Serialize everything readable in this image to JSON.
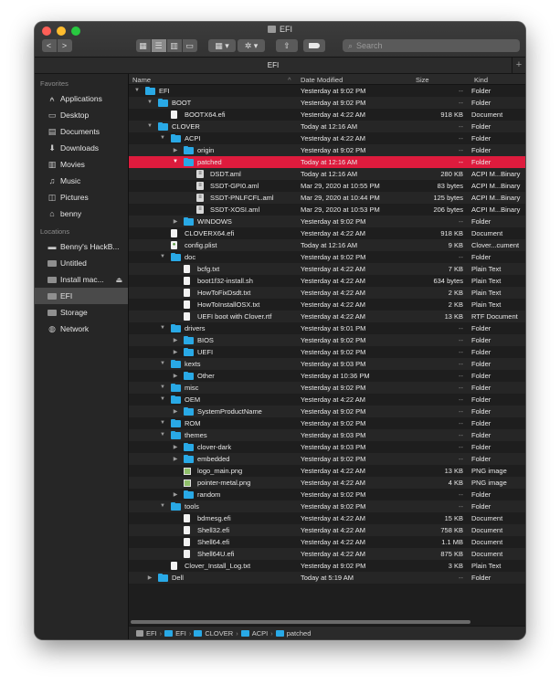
{
  "window": {
    "title": "EFI"
  },
  "toolbar": {
    "back_label": "<",
    "forward_label": ">",
    "search_placeholder": "Search"
  },
  "tab": {
    "title": "EFI",
    "plus": "+"
  },
  "sidebar": {
    "favorites_header": "Favorites",
    "favorites": [
      {
        "label": "Applications",
        "icon": "applications-icon"
      },
      {
        "label": "Desktop",
        "icon": "desktop-icon"
      },
      {
        "label": "Documents",
        "icon": "documents-icon"
      },
      {
        "label": "Downloads",
        "icon": "downloads-icon"
      },
      {
        "label": "Movies",
        "icon": "movies-icon"
      },
      {
        "label": "Music",
        "icon": "music-icon"
      },
      {
        "label": "Pictures",
        "icon": "pictures-icon"
      },
      {
        "label": "benny",
        "icon": "home-icon"
      }
    ],
    "locations_header": "Locations",
    "locations": [
      {
        "label": "Benny's HackB...",
        "icon": "computer-icon"
      },
      {
        "label": "Untitled",
        "icon": "drive-icon"
      },
      {
        "label": "Install mac...",
        "icon": "drive-icon",
        "eject": true
      },
      {
        "label": "EFI",
        "icon": "drive-icon",
        "selected": true
      },
      {
        "label": "Storage",
        "icon": "drive-icon"
      },
      {
        "label": "Network",
        "icon": "network-icon"
      }
    ]
  },
  "columns": {
    "name": "Name",
    "date": "Date Modified",
    "size": "Size",
    "kind": "Kind"
  },
  "rows": [
    {
      "depth": 0,
      "disc": "open",
      "icon": "folder",
      "name": "EFI",
      "date": "Yesterday at 9:02 PM",
      "size": "--",
      "kind": "Folder"
    },
    {
      "depth": 1,
      "disc": "open",
      "icon": "folder",
      "name": "BOOT",
      "date": "Yesterday at 9:02 PM",
      "size": "--",
      "kind": "Folder"
    },
    {
      "depth": 2,
      "disc": "none",
      "icon": "doc",
      "name": "BOOTX64.efi",
      "date": "Yesterday at 4:22 AM",
      "size": "918 KB",
      "kind": "Document"
    },
    {
      "depth": 1,
      "disc": "open",
      "icon": "folder",
      "name": "CLOVER",
      "date": "Today at 12:16 AM",
      "size": "--",
      "kind": "Folder"
    },
    {
      "depth": 2,
      "disc": "open",
      "icon": "folder",
      "name": "ACPI",
      "date": "Yesterday at 4:22 AM",
      "size": "--",
      "kind": "Folder"
    },
    {
      "depth": 3,
      "disc": "closed",
      "icon": "folder",
      "name": "origin",
      "date": "Yesterday at 9:02 PM",
      "size": "--",
      "kind": "Folder"
    },
    {
      "depth": 3,
      "disc": "open",
      "icon": "folder",
      "name": "patched",
      "date": "Today at 12:16 AM",
      "size": "--",
      "kind": "Folder",
      "selected": true
    },
    {
      "depth": 4,
      "disc": "none",
      "icon": "aml",
      "name": "DSDT.aml",
      "date": "Today at 12:16 AM",
      "size": "280 KB",
      "kind": "ACPI M...Binary"
    },
    {
      "depth": 4,
      "disc": "none",
      "icon": "aml",
      "name": "SSDT-GPI0.aml",
      "date": "Mar 29, 2020 at 10:55 PM",
      "size": "83 bytes",
      "kind": "ACPI M...Binary"
    },
    {
      "depth": 4,
      "disc": "none",
      "icon": "aml",
      "name": "SSDT-PNLFCFL.aml",
      "date": "Mar 29, 2020 at 10:44 PM",
      "size": "125 bytes",
      "kind": "ACPI M...Binary"
    },
    {
      "depth": 4,
      "disc": "none",
      "icon": "aml",
      "name": "SSDT-XOSI.aml",
      "date": "Mar 29, 2020 at 10:53 PM",
      "size": "206 bytes",
      "kind": "ACPI M...Binary"
    },
    {
      "depth": 3,
      "disc": "closed",
      "icon": "folder",
      "name": "WINDOWS",
      "date": "Yesterday at 9:02 PM",
      "size": "--",
      "kind": "Folder"
    },
    {
      "depth": 2,
      "disc": "none",
      "icon": "doc",
      "name": "CLOVERX64.efi",
      "date": "Yesterday at 4:22 AM",
      "size": "918 KB",
      "kind": "Document"
    },
    {
      "depth": 2,
      "disc": "none",
      "icon": "plist",
      "name": "config.plist",
      "date": "Today at 12:16 AM",
      "size": "9 KB",
      "kind": "Clover...cument"
    },
    {
      "depth": 2,
      "disc": "open",
      "icon": "folder",
      "name": "doc",
      "date": "Yesterday at 9:02 PM",
      "size": "--",
      "kind": "Folder"
    },
    {
      "depth": 3,
      "disc": "none",
      "icon": "doc",
      "name": "bcfg.txt",
      "date": "Yesterday at 4:22 AM",
      "size": "7 KB",
      "kind": "Plain Text"
    },
    {
      "depth": 3,
      "disc": "none",
      "icon": "doc",
      "name": "boot1f32-install.sh",
      "date": "Yesterday at 4:22 AM",
      "size": "634 bytes",
      "kind": "Plain Text"
    },
    {
      "depth": 3,
      "disc": "none",
      "icon": "doc",
      "name": "HowToFixDsdt.txt",
      "date": "Yesterday at 4:22 AM",
      "size": "2 KB",
      "kind": "Plain Text"
    },
    {
      "depth": 3,
      "disc": "none",
      "icon": "doc",
      "name": "HowToInstallOSX.txt",
      "date": "Yesterday at 4:22 AM",
      "size": "2 KB",
      "kind": "Plain Text"
    },
    {
      "depth": 3,
      "disc": "none",
      "icon": "doc",
      "name": "UEFI boot with Clover.rtf",
      "date": "Yesterday at 4:22 AM",
      "size": "13 KB",
      "kind": "RTF Document"
    },
    {
      "depth": 2,
      "disc": "open",
      "icon": "folder",
      "name": "drivers",
      "date": "Yesterday at 9:01 PM",
      "size": "--",
      "kind": "Folder"
    },
    {
      "depth": 3,
      "disc": "closed",
      "icon": "folder",
      "name": "BIOS",
      "date": "Yesterday at 9:02 PM",
      "size": "--",
      "kind": "Folder"
    },
    {
      "depth": 3,
      "disc": "closed",
      "icon": "folder",
      "name": "UEFI",
      "date": "Yesterday at 9:02 PM",
      "size": "--",
      "kind": "Folder"
    },
    {
      "depth": 2,
      "disc": "open",
      "icon": "folder",
      "name": "kexts",
      "date": "Yesterday at 9:03 PM",
      "size": "--",
      "kind": "Folder"
    },
    {
      "depth": 3,
      "disc": "closed",
      "icon": "folder",
      "name": "Other",
      "date": "Yesterday at 10:36 PM",
      "size": "--",
      "kind": "Folder"
    },
    {
      "depth": 2,
      "disc": "open",
      "icon": "folder",
      "name": "misc",
      "date": "Yesterday at 9:02 PM",
      "size": "--",
      "kind": "Folder"
    },
    {
      "depth": 2,
      "disc": "open",
      "icon": "folder",
      "name": "OEM",
      "date": "Yesterday at 4:22 AM",
      "size": "--",
      "kind": "Folder"
    },
    {
      "depth": 3,
      "disc": "closed",
      "icon": "folder",
      "name": "SystemProductName",
      "date": "Yesterday at 9:02 PM",
      "size": "--",
      "kind": "Folder"
    },
    {
      "depth": 2,
      "disc": "open",
      "icon": "folder",
      "name": "ROM",
      "date": "Yesterday at 9:02 PM",
      "size": "--",
      "kind": "Folder"
    },
    {
      "depth": 2,
      "disc": "open",
      "icon": "folder",
      "name": "themes",
      "date": "Yesterday at 9:03 PM",
      "size": "--",
      "kind": "Folder"
    },
    {
      "depth": 3,
      "disc": "closed",
      "icon": "folder",
      "name": "clover-dark",
      "date": "Yesterday at 9:03 PM",
      "size": "--",
      "kind": "Folder"
    },
    {
      "depth": 3,
      "disc": "closed",
      "icon": "folder",
      "name": "embedded",
      "date": "Yesterday at 9:02 PM",
      "size": "--",
      "kind": "Folder"
    },
    {
      "depth": 3,
      "disc": "none",
      "icon": "png",
      "name": "logo_main.png",
      "date": "Yesterday at 4:22 AM",
      "size": "13 KB",
      "kind": "PNG image"
    },
    {
      "depth": 3,
      "disc": "none",
      "icon": "png",
      "name": "pointer-metal.png",
      "date": "Yesterday at 4:22 AM",
      "size": "4 KB",
      "kind": "PNG image"
    },
    {
      "depth": 3,
      "disc": "closed",
      "icon": "folder",
      "name": "random",
      "date": "Yesterday at 9:02 PM",
      "size": "--",
      "kind": "Folder"
    },
    {
      "depth": 2,
      "disc": "open",
      "icon": "folder",
      "name": "tools",
      "date": "Yesterday at 9:02 PM",
      "size": "--",
      "kind": "Folder"
    },
    {
      "depth": 3,
      "disc": "none",
      "icon": "doc",
      "name": "bdmesg.efi",
      "date": "Yesterday at 4:22 AM",
      "size": "15 KB",
      "kind": "Document"
    },
    {
      "depth": 3,
      "disc": "none",
      "icon": "doc",
      "name": "Shell32.efi",
      "date": "Yesterday at 4:22 AM",
      "size": "758 KB",
      "kind": "Document"
    },
    {
      "depth": 3,
      "disc": "none",
      "icon": "doc",
      "name": "Shell64.efi",
      "date": "Yesterday at 4:22 AM",
      "size": "1.1 MB",
      "kind": "Document"
    },
    {
      "depth": 3,
      "disc": "none",
      "icon": "doc",
      "name": "Shell64U.efi",
      "date": "Yesterday at 4:22 AM",
      "size": "875 KB",
      "kind": "Document"
    },
    {
      "depth": 2,
      "disc": "none",
      "icon": "doc",
      "name": "Clover_Install_Log.txt",
      "date": "Yesterday at 9:02 PM",
      "size": "3 KB",
      "kind": "Plain Text"
    },
    {
      "depth": 1,
      "disc": "closed",
      "icon": "folder",
      "name": "Dell",
      "date": "Today at 5:19 AM",
      "size": "--",
      "kind": "Folder"
    }
  ],
  "pathbar": [
    {
      "label": "EFI",
      "icon": "drive-icon"
    },
    {
      "label": "EFI",
      "icon": "folder-icon"
    },
    {
      "label": "CLOVER",
      "icon": "folder-icon"
    },
    {
      "label": "ACPI",
      "icon": "folder-icon"
    },
    {
      "label": "patched",
      "icon": "folder-icon"
    }
  ],
  "colors": {
    "selection": "#de1b3d",
    "folder": "#29a9e6"
  }
}
